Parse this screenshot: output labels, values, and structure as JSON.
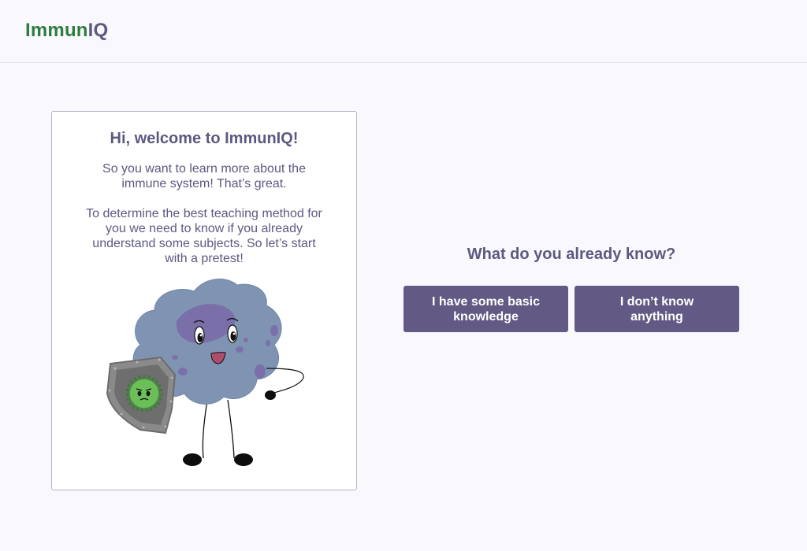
{
  "header": {
    "logo_part1": "Immun",
    "logo_part2": "IQ"
  },
  "welcome_card": {
    "title": "Hi, welcome to ImmunIQ!",
    "paragraph1": "So you want to learn more about the immune system! That’s great.",
    "paragraph2": "To determine the best teaching method for you we need to know if you already understand some subjects. So let’s start with a pretest!",
    "illustration": "immune-cell-mascot-with-shield"
  },
  "pretest": {
    "question": "What do you already know?",
    "options": [
      {
        "label": "I have some basic knowledge"
      },
      {
        "label": "I don’t know anything"
      }
    ]
  },
  "colors": {
    "brand_green": "#2f7d3e",
    "brand_purple": "#5c5980",
    "button_bg": "#625a84",
    "background": "#f9f8fc",
    "cell_body": "#7f94b3",
    "cell_spots": "#7a68a8"
  }
}
